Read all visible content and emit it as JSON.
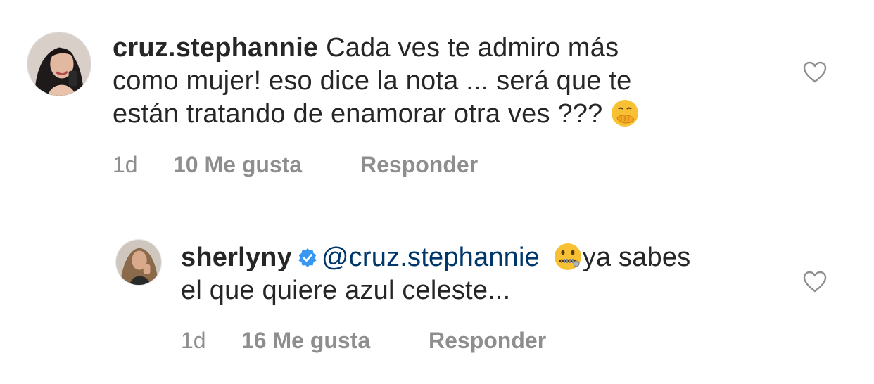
{
  "comments": [
    {
      "username": "cruz.stephannie",
      "text_line1": "Cada ves te admiro más",
      "text_line2": "como mujer!  eso dice la nota ... será que te",
      "text_line3": "están tratando de enamorar otra ves ???",
      "emoji": "face-with-hand-over-mouth",
      "time": "1d",
      "likes": "10 Me gusta",
      "reply_label": "Responder",
      "verified": false
    },
    {
      "username": "sherlyny",
      "mention": "@cruz.stephannie",
      "emoji": "zipper-mouth-face",
      "text_line1_after": "ya sabes",
      "text_line2": "el que quiere azul celeste...",
      "time": "1d",
      "likes": "16 Me gusta",
      "reply_label": "Responder",
      "verified": true
    }
  ],
  "colors": {
    "text": "#262626",
    "secondary": "#8e8e8e",
    "mention": "#00376b",
    "verified": "#3897f0"
  },
  "icons": [
    "heart-outline-icon",
    "verified-badge-icon"
  ]
}
